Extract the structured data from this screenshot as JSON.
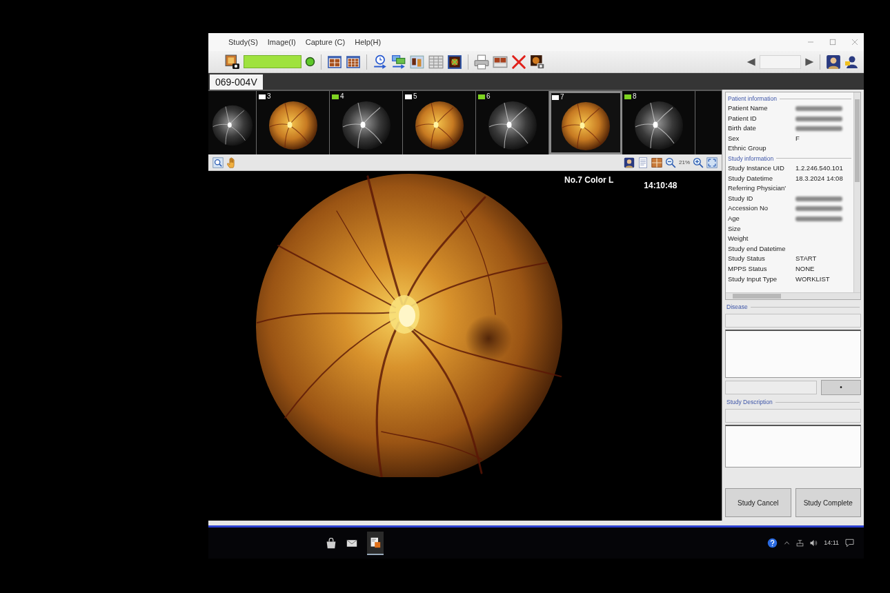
{
  "menu": [
    "Study(S)",
    "Image(I)",
    "Capture (C)",
    "Help(H)"
  ],
  "tab": "069-004V",
  "thumbnails": [
    {
      "kind": "monochrome",
      "selected": false
    },
    {
      "label": "3",
      "color": "#ffffff",
      "kind": "color",
      "selected": false
    },
    {
      "label": "4",
      "color": "#7ed321",
      "kind": "monochrome",
      "selected": false
    },
    {
      "label": "5",
      "color": "#ffffff",
      "kind": "color",
      "selected": false
    },
    {
      "label": "6",
      "color": "#7ed321",
      "kind": "monochrome",
      "selected": false
    },
    {
      "label": "7",
      "color": "#ffffff",
      "kind": "color",
      "selected": true
    },
    {
      "label": "8",
      "color": "#7ed321",
      "kind": "monochrome",
      "selected": false
    }
  ],
  "viewer": {
    "zoom": "21%",
    "image_title": "No.7 Color L",
    "time": "14:10:48"
  },
  "info": [
    {
      "title": "Patient information",
      "rows": [
        {
          "label": "Patient Name",
          "blurred": true
        },
        {
          "label": "Patient ID",
          "blurred": true
        },
        {
          "label": "Birth date",
          "blurred": true
        },
        {
          "label": "Sex",
          "value": "F",
          "blurred": false
        },
        {
          "label": "Ethnic Group",
          "blurred": false
        }
      ]
    },
    {
      "title": "Study information",
      "rows": [
        {
          "label": "Study Instance UID",
          "value": "1.2.246.540.101",
          "blurred": false
        },
        {
          "label": "Study Datetime",
          "value": "18.3.2024 14:08",
          "blurred": false
        },
        {
          "label": "Referring Physician'",
          "blurred": false
        },
        {
          "label": "Study ID",
          "blurred": true
        },
        {
          "label": "Accession No",
          "blurred": true
        },
        {
          "label": "Age",
          "blurred": true
        },
        {
          "label": "Size",
          "blurred": false
        },
        {
          "label": "Weight",
          "blurred": false
        },
        {
          "label": "Study end Datetime",
          "blurred": false
        },
        {
          "label": "Study Status",
          "value": "START",
          "blurred": false
        },
        {
          "label": "MPPS Status",
          "value": "NONE",
          "blurred": false
        },
        {
          "label": "Study Input Type",
          "value": "WORKLIST",
          "blurred": false
        }
      ]
    }
  ],
  "disease": {
    "title": "Disease",
    "button": "•"
  },
  "description": {
    "title": "Study Description"
  },
  "actions": [
    "Study Cancel",
    "Study Complete"
  ],
  "taskbar": {
    "clock": "14:11"
  }
}
